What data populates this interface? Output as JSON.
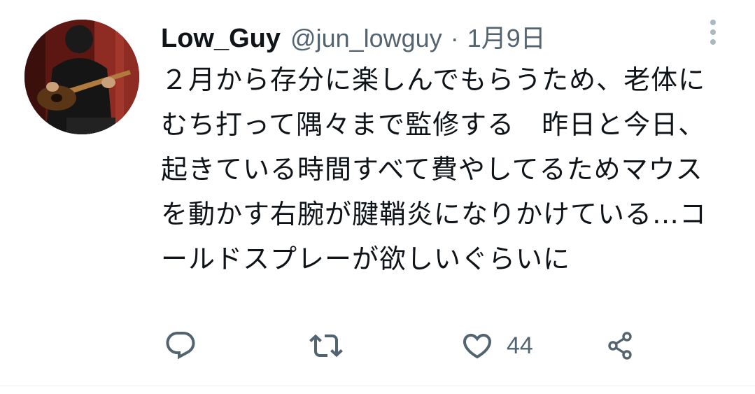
{
  "tweet": {
    "display_name": "Low_Guy",
    "handle": "@jun_lowguy",
    "separator": "·",
    "date": "1月9日",
    "text": "２月から存分に楽しんでもらうため、老体にむち打って隅々まで監修する　昨日と今日、起きている時間すべて費やしてるためマウスを動かす右腕が腱鞘炎になりかけている…コールドスプレーが欲しいぐらいに"
  },
  "actions": {
    "reply_icon": "reply-icon",
    "retweet_icon": "retweet-icon",
    "like_icon": "like-icon",
    "like_count": "44",
    "share_icon": "share-icon"
  },
  "colors": {
    "text_primary": "#0f1419",
    "text_secondary": "#536471",
    "icon_muted": "#aab8c2"
  }
}
